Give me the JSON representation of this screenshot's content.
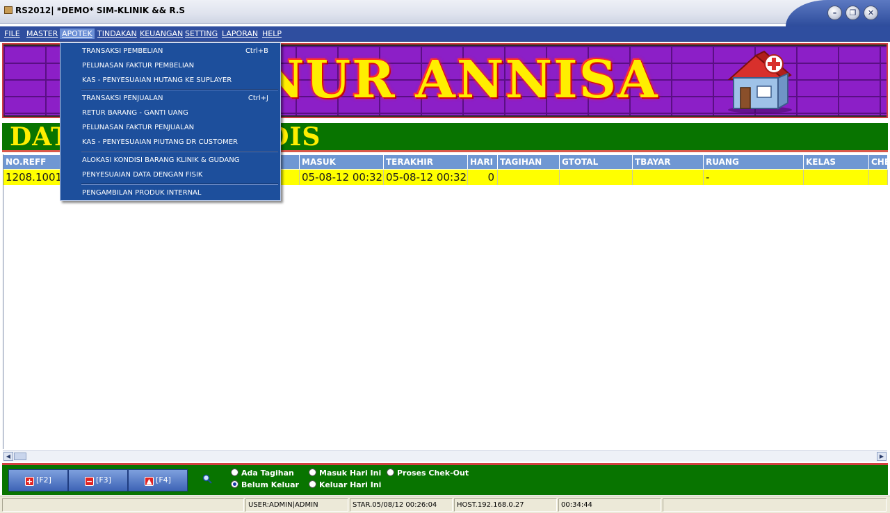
{
  "window": {
    "title": "RS2012| *DEMO* SIM-KLINIK && R.S",
    "minimize": "–",
    "restore": "❐",
    "close": "✕"
  },
  "menubar": {
    "items": [
      "FILE",
      "MASTER",
      "APOTEK",
      "TINDAKAN",
      "KEUANGAN",
      "SETTING",
      "LAPORAN",
      "HELP"
    ],
    "active": "APOTEK"
  },
  "banner": {
    "title": "NUR ANNISA",
    "icon": "house-medical-icon"
  },
  "section": {
    "title": "DATA REKAM MEDIS"
  },
  "apotek_menu": {
    "items": [
      {
        "label": "TRANSAKSI PEMBELIAN",
        "shortcut": "Ctrl+B"
      },
      {
        "label": "PELUNASAN FAKTUR PEMBELIAN",
        "shortcut": ""
      },
      {
        "label": "KAS - PENYESUAIAN HUTANG KE SUPLAYER",
        "shortcut": ""
      },
      {
        "label": "TRANSAKSI PENJUALAN",
        "shortcut": "Ctrl+J"
      },
      {
        "label": "RETUR BARANG - GANTI UANG",
        "shortcut": ""
      },
      {
        "label": "PELUNASAN FAKTUR PENJUALAN",
        "shortcut": ""
      },
      {
        "label": "KAS - PENYESUAIAN PIUTANG DR CUSTOMER",
        "shortcut": ""
      },
      {
        "label": "ALOKASI KONDISI BARANG KLINIK & GUDANG",
        "shortcut": ""
      },
      {
        "label": "PENYESUAIAN DATA DENGAN FISIK",
        "shortcut": ""
      },
      {
        "label": "PENGAMBILAN PRODUK INTERNAL",
        "shortcut": ""
      }
    ]
  },
  "table": {
    "columns": [
      "NO.REFF",
      "",
      "MASUK",
      "TERAKHIR",
      "HARI",
      "TAGIHAN",
      "GTOTAL",
      "TBAYAR",
      "RUANG",
      "KELAS",
      "CHE"
    ],
    "rows": [
      [
        "1208.1001",
        "",
        "05-08-12 00:32",
        "05-08-12 00:32",
        "0",
        "",
        "",
        "",
        "-",
        "",
        ""
      ]
    ]
  },
  "toolbar": {
    "buttons": [
      {
        "label": "[F2]",
        "icon": "add-icon"
      },
      {
        "label": "[F3]",
        "icon": "remove-icon"
      },
      {
        "label": "[F4]",
        "icon": "up-icon"
      }
    ],
    "search_icon": "search-icon",
    "filters": [
      {
        "label": "Ada Tagihan",
        "checked": false
      },
      {
        "label": "Belum Keluar",
        "checked": true
      },
      {
        "label": "Masuk Hari Ini",
        "checked": false
      },
      {
        "label": "Keluar Hari Ini",
        "checked": false
      },
      {
        "label": "Proses Chek-Out",
        "checked": false
      }
    ]
  },
  "statusbar": {
    "user": "USER:ADMIN|ADMIN",
    "start": "STAR.05/08/12 00:26:04",
    "host": "HOST.192.168.0.27",
    "clock": "00:34:44"
  },
  "colors": {
    "menubar": "#2f4e9f",
    "banner_purple": "#8c1fc7",
    "banner_text": "#ffee00",
    "green": "#087400",
    "row_highlight": "#ffff00",
    "header_blue": "#6f97d3"
  }
}
